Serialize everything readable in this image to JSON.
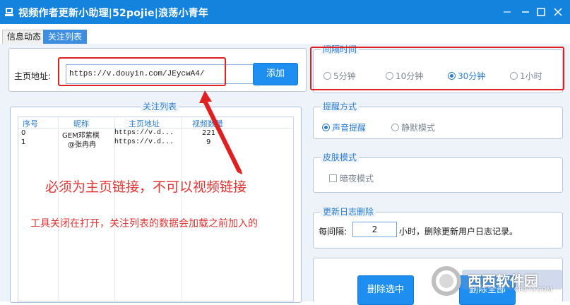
{
  "window": {
    "title": "视频作者更新小助理|52pojie|浪荡小青年",
    "icons": {
      "app": "app-icon",
      "min": "minimize-icon",
      "max": "maximize-icon",
      "close": "close-icon"
    }
  },
  "tabs": [
    {
      "label": "信息动态"
    },
    {
      "label": "关注列表"
    }
  ],
  "url_section": {
    "label": "主页地址:",
    "value": "https://v.douyin.com/JEycwA4/",
    "add_button": "添加"
  },
  "interval": {
    "legend": "间隔时间",
    "options": [
      "5分钟",
      "10分钟",
      "30分钟",
      "1小时"
    ],
    "selected": "30分钟"
  },
  "follow_list": {
    "legend": "关注列表",
    "columns": [
      "序号",
      "昵称",
      "主页地址",
      "视频数量"
    ],
    "rows": [
      {
        "index": "0",
        "nickname": "GEM邓紫棋",
        "url": "https://v.d...",
        "count": "221"
      },
      {
        "index": "1",
        "nickname": "@张冉冉",
        "url": "https://v.d...",
        "count": "9"
      }
    ]
  },
  "reminder": {
    "legend": "提醒方式",
    "options": [
      "声音提醒",
      "静默模式"
    ],
    "selected": "声音提醒"
  },
  "skin": {
    "legend": "皮肤模式",
    "checkbox_label": "暗夜模式"
  },
  "log": {
    "legend": "更新日志删除",
    "prefix": "每间隔:",
    "value": "2",
    "suffix": "小时，删除更新用户日志记录。"
  },
  "buttons": {
    "delete_selected": "删除选中",
    "delete_all": "删除全部"
  },
  "annotations": {
    "big": "必须为主页链接，不可以视频链接",
    "small": "工具关闭在打开，关注列表的数据会加载之前加入的"
  },
  "watermark": {
    "text": "西西软件园",
    "sub": "CR173.COM"
  },
  "colors": {
    "titlebar": "#1383de",
    "accent": "#2a7dd1",
    "button": "#1e8ff0",
    "annotation": "#e33434"
  }
}
